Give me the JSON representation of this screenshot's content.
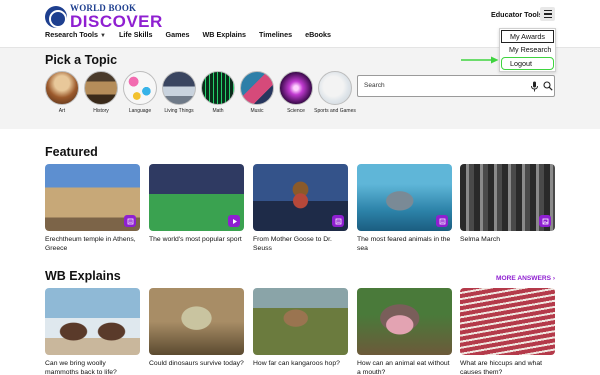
{
  "brand": {
    "top": "WORLD BOOK",
    "bottom": "DISCOVER"
  },
  "nav": {
    "items": [
      "Research Tools",
      "Life Skills",
      "Games",
      "WB Explains",
      "Timelines",
      "eBooks"
    ]
  },
  "header": {
    "educator_tools": "Educator Tools"
  },
  "dropdown": {
    "items": [
      "My Awards",
      "My Research",
      "Logout"
    ]
  },
  "topics": {
    "title": "Pick a Topic",
    "items": [
      "Art",
      "History",
      "Language",
      "Living Things",
      "Math",
      "Music",
      "Science",
      "Sports and Games"
    ]
  },
  "search": {
    "placeholder": "Search"
  },
  "featured": {
    "title": "Featured",
    "cards": [
      {
        "caption": "Erechtheum temple in Athens, Greece",
        "badge": "article-icon"
      },
      {
        "caption": "The world's most popular sport",
        "badge": "play-icon"
      },
      {
        "caption": "From Mother Goose to Dr. Seuss",
        "badge": "article-icon"
      },
      {
        "caption": "The most feared animals in the sea",
        "badge": "article-icon"
      },
      {
        "caption": "Selma March",
        "badge": "image-icon"
      }
    ]
  },
  "explains": {
    "title": "WB Explains",
    "more": "MORE ANSWERS ›",
    "cards": [
      {
        "caption": "Can we bring woolly mammoths back to life?"
      },
      {
        "caption": "Could dinosaurs survive today?"
      },
      {
        "caption": "How far can kangaroos hop?"
      },
      {
        "caption": "How can an animal eat without a mouth?"
      },
      {
        "caption": "What are hiccups and what causes them?"
      }
    ]
  },
  "colors": {
    "brand_purple": "#8f1fd1",
    "brand_blue": "#1e3f8f",
    "annotation_green": "#3fd43f"
  }
}
